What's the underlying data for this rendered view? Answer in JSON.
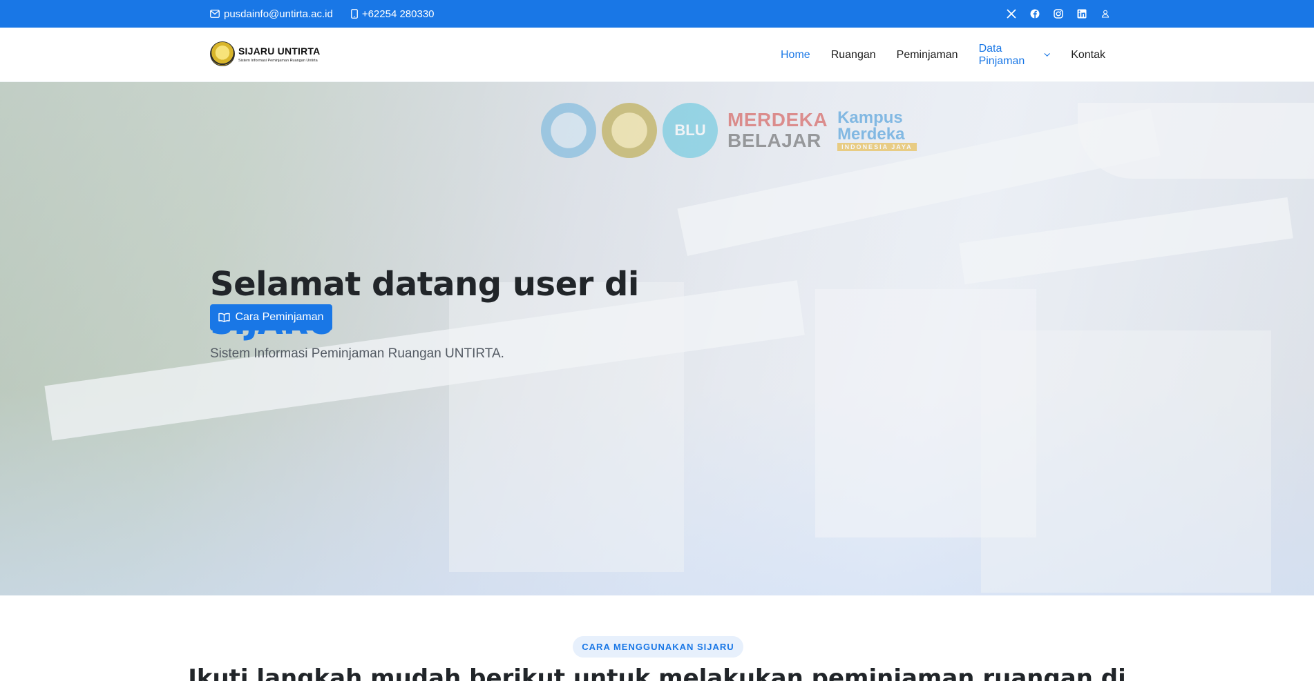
{
  "topbar": {
    "email": "pusdainfo@untirta.ac.id",
    "phone": "+62254 280330",
    "social_icons": [
      "x-twitter-icon",
      "facebook-icon",
      "instagram-icon",
      "linkedin-icon",
      "user-icon"
    ]
  },
  "header": {
    "logo_name": "SIJARU UNTIRTA",
    "logo_subtitle": "Sistem Informasi Peminjaman Ruangan Untirta",
    "nav": [
      {
        "label": "Home",
        "active": true
      },
      {
        "label": "Ruangan"
      },
      {
        "label": "Peminjaman"
      },
      {
        "label": "Data Pinjaman",
        "dropdown": true
      },
      {
        "label": "Kontak"
      }
    ]
  },
  "hero": {
    "partners": {
      "blu_text": "BLU",
      "merdeka_line1": "MERDEKA",
      "merdeka_line2": "BELAJAR",
      "kampus_line1": "Kampus",
      "kampus_line2": "Merdeka",
      "kampus_tagline": "INDONESIA JAYA"
    },
    "title_line1": "Selamat datang user di",
    "title_accent": "SIJARU",
    "subtitle": "Sistem Informasi Peminjaman Ruangan UNTIRTA.",
    "cta_label": "Cara Peminjaman"
  },
  "section": {
    "badge": "CARA MENGGUNAKAN SIJARU",
    "title": "Ikuti langkah mudah berikut untuk melakukan peminjaman ruangan di"
  },
  "colors": {
    "primary": "#1977e6",
    "text_dark": "#212529",
    "badge_bg": "#e7f0fc"
  }
}
